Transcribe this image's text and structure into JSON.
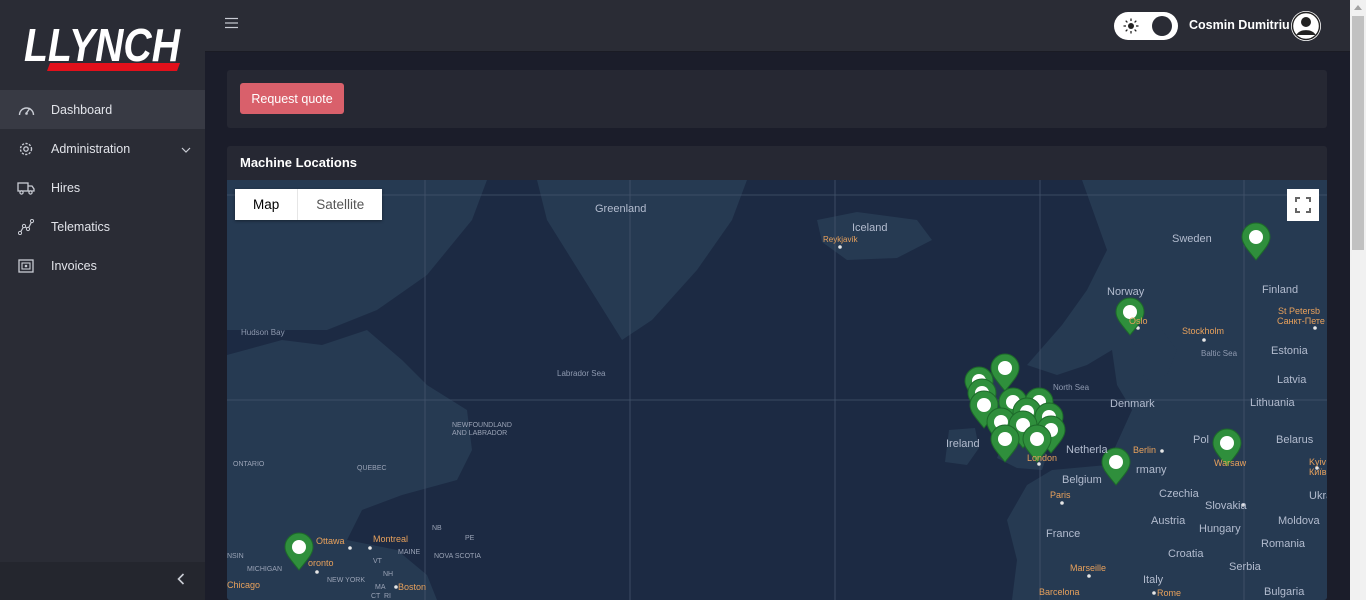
{
  "brand": {
    "logo_text": "LLYNCH",
    "accent": "#e2101b"
  },
  "sidebar": {
    "items": [
      {
        "label": "Dashboard",
        "icon": "dashboard-icon",
        "active": true
      },
      {
        "label": "Administration",
        "icon": "gear-icon"
      },
      {
        "label": "Hires",
        "icon": "truck-icon"
      },
      {
        "label": "Telematics",
        "icon": "telematics-icon"
      },
      {
        "label": "Invoices",
        "icon": "invoice-icon"
      }
    ]
  },
  "header": {
    "user_name": "Cosmin Dumitriu",
    "theme_toggle": "dark"
  },
  "actions": {
    "request_quote": "Request quote"
  },
  "map_card": {
    "title": "Machine Locations",
    "map_types": [
      "Map",
      "Satellite"
    ],
    "selected_map_type": "Map",
    "labels": {
      "greenland": "Greenland",
      "iceland": "Iceland",
      "reykjavik": "Reykjavík",
      "sweden": "Sweden",
      "norway": "Norway",
      "finland": "Finland",
      "oslo": "Oslo",
      "stockholm": "Stockholm",
      "st_petersburg": "St Petersb",
      "st_petersburg_ru": "Санкт-Пете",
      "baltic_sea": "Baltic Sea",
      "estonia": "Estonia",
      "latvia": "Latvia",
      "lithuania": "Lithuania",
      "denmark": "Denmark",
      "north_sea": "North Sea",
      "hudson_bay": "Hudson Bay",
      "labrador_sea": "Labrador Sea",
      "newfoundland_1": "NEWFOUNDLAND",
      "newfoundland_2": "AND LABRADOR",
      "ontario": "ONTARIO",
      "quebec": "QUEBEC",
      "ireland": "Ireland",
      "london": "London",
      "netherlands": "Netherla",
      "germany": "rmany",
      "berlin": "Berlin",
      "poland": "Pol",
      "warsaw": "Warsaw",
      "belarus": "Belarus",
      "kyiv_1": "Kyiv",
      "kyiv_2": "Київ",
      "ukraine": "Ukra",
      "belgium": "Belgium",
      "paris": "Paris",
      "czechia": "Czechia",
      "slovakia": "Slovakia",
      "moldova": "Moldova",
      "austria": "Austria",
      "hungary": "Hungary",
      "france": "France",
      "romania": "Romania",
      "croatia": "Croatia",
      "serbia": "Serbia",
      "marseille": "Marseille",
      "italy": "Italy",
      "barcelona": "Barcelona",
      "rome": "Rome",
      "bulgaria": "Bulgaria",
      "ottawa": "Ottawa",
      "montreal": "Montreal",
      "toronto": "oronto",
      "maine": "MAINE",
      "vt": "VT",
      "nh": "NH",
      "nb": "NB",
      "pe": "PE",
      "nova_scotia": "NOVA SCOTIA",
      "michigan": "MICHIGAN",
      "new_york": "NEW YORK",
      "ma": "MA",
      "boston": "Boston",
      "ct": "CT",
      "ri": "RI",
      "chicago": "Chicago",
      "wisconsin": "NSIN"
    }
  },
  "colors": {
    "marker": "#2f8f3c",
    "city_label": "#e8a15c",
    "country_label": "#b3bccf",
    "water": "#1c2a43",
    "land": "#263a52"
  }
}
